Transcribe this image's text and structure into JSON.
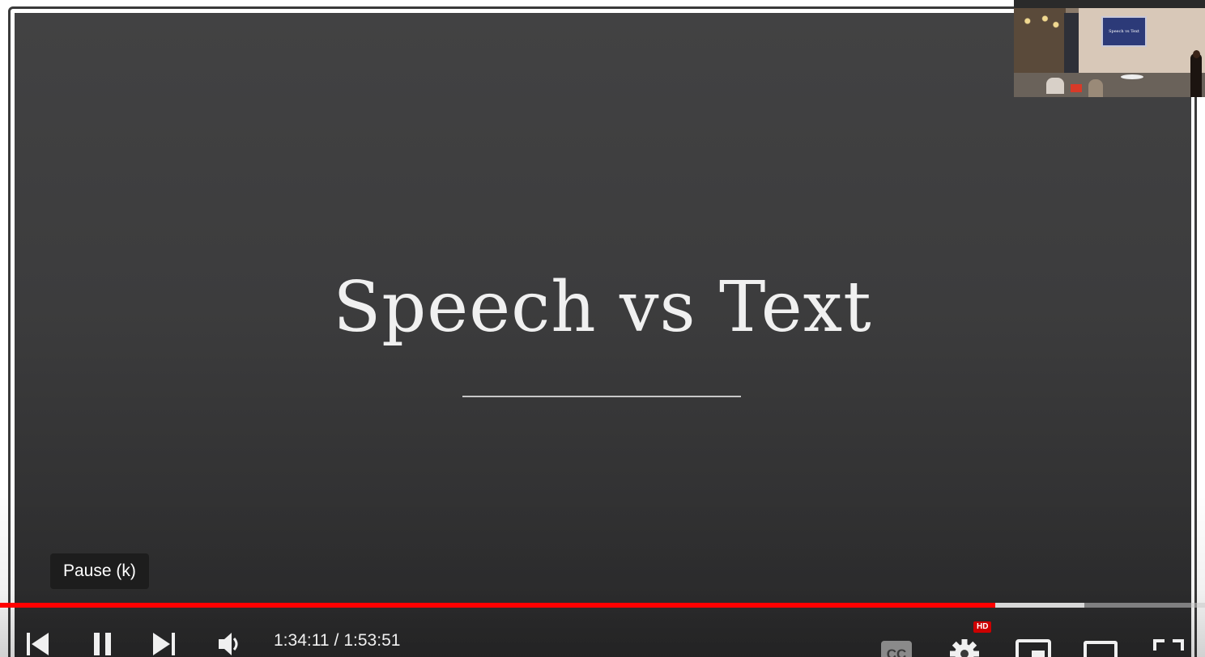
{
  "slide": {
    "title": "Speech vs Text"
  },
  "pip": {
    "screen_text": "Speech vs Text"
  },
  "tooltip": {
    "text": "Pause (k)"
  },
  "progress": {
    "played_fraction": 0.826,
    "buffered_fraction": 0.9
  },
  "time": {
    "current": "1:34:11",
    "separator": "/",
    "duration": "1:53:51"
  },
  "settings": {
    "quality_badge": "HD"
  },
  "icons": {
    "previous": "skip-previous-icon",
    "pause": "pause-icon",
    "next": "skip-next-icon",
    "volume": "volume-icon",
    "captions": "captions-icon",
    "settings": "gear-icon",
    "miniplayer": "miniplayer-icon",
    "theater": "theater-mode-icon",
    "fullscreen": "fullscreen-icon"
  },
  "colors": {
    "progress_played": "#ff0000",
    "hd_badge": "#cc0000",
    "slide_bg": "#3c3c3d"
  }
}
